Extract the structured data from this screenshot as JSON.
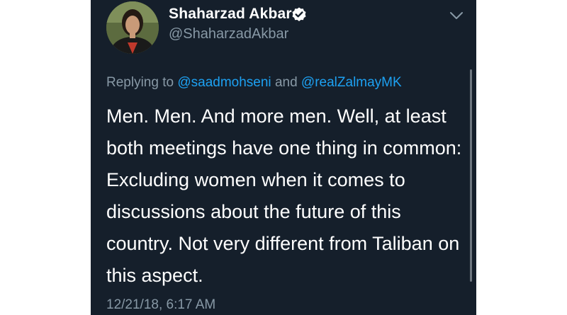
{
  "user": {
    "display_name": "Shaharzad Akbar",
    "handle": "@ShaharzadAkbar",
    "verified": true,
    "avatar_icon": "profile-photo"
  },
  "reply": {
    "prefix": "Replying to",
    "mention_1": "@saadmohseni",
    "conjunction": "and",
    "mention_2": "@realZalmayMK"
  },
  "tweet": {
    "text": "Men. Men. And more men. Well, at least both meetings have one thing in common: Excluding women when it comes to discussions about the future of this country. Not very different from Taliban on this aspect.",
    "timestamp": "12/21/18, 6:17 AM"
  },
  "colors": {
    "background": "#151f2b",
    "text": "#ffffff",
    "muted": "#8899a6",
    "accent": "#1da1f2"
  },
  "icons": {
    "verified": "verified-badge-icon",
    "more": "chevron-down-icon"
  }
}
